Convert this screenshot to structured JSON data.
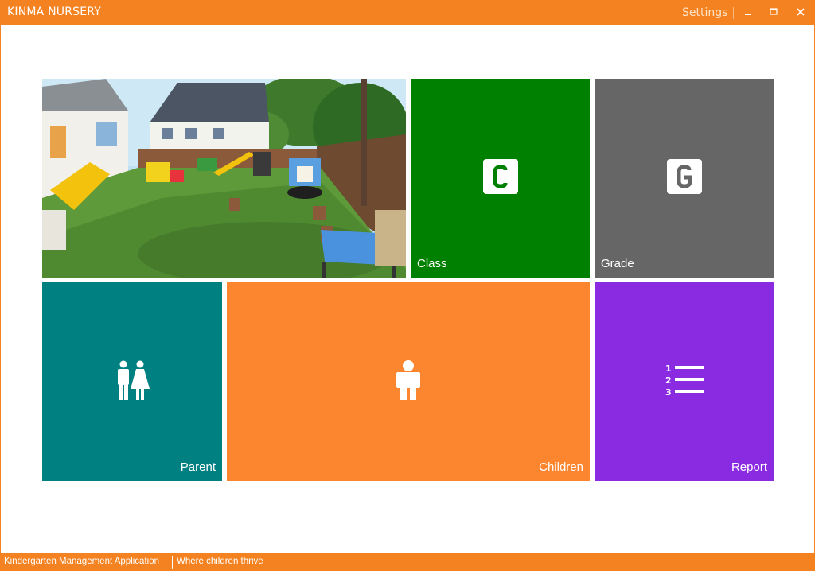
{
  "window": {
    "title": "KINMA NURSERY",
    "settings_label": "Settings"
  },
  "tiles": {
    "photo": {
      "alt": "nursery playground photo"
    },
    "class": {
      "label": "Class",
      "icon": "letter-c-icon",
      "color": "#008000"
    },
    "grade": {
      "label": "Grade",
      "icon": "letter-g-icon",
      "color": "#666666"
    },
    "parent": {
      "label": "Parent",
      "icon": "parents-icon",
      "color": "#008080"
    },
    "children": {
      "label": "Children",
      "icon": "child-icon",
      "color": "#fc8530"
    },
    "report": {
      "label": "Report",
      "icon": "numbered-list-icon",
      "color": "#8a2be2"
    }
  },
  "statusbar": {
    "app_name": "Kindergarten Management Application",
    "tagline": "Where children thrive"
  },
  "colors": {
    "accent": "#f58220"
  }
}
